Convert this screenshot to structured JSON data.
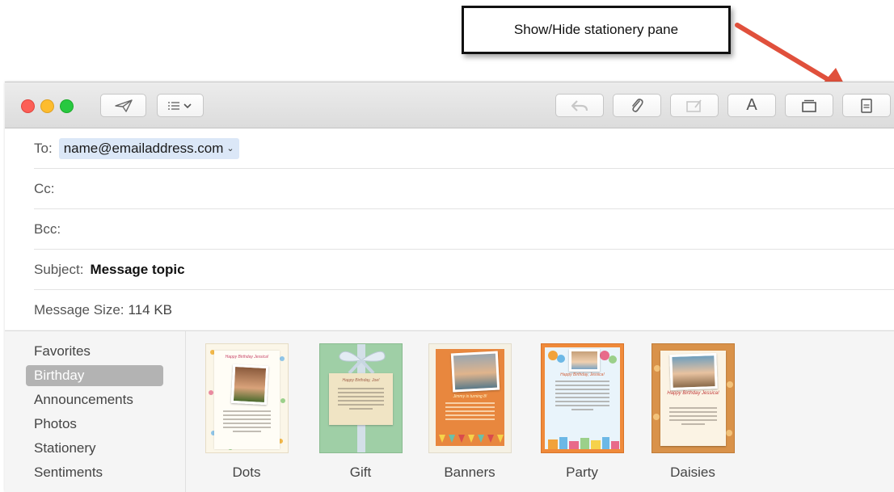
{
  "callout": {
    "text": "Show/Hide stationery pane"
  },
  "toolbar": {
    "send_icon": "paper-plane-icon",
    "header_fields_icon": "list-menu-icon",
    "reply_icon": "reply-arrow-icon",
    "attach_icon": "paperclip-icon",
    "markup_icon": "markup-photo-icon",
    "format_label": "A",
    "photo_browser_icon": "photo-browser-icon",
    "stationery_icon": "stationery-icon"
  },
  "headers": {
    "to_label": "To:",
    "to_value": "name@emailaddress.com",
    "cc_label": "Cc:",
    "bcc_label": "Bcc:",
    "subject_label": "Subject:",
    "subject_value": "Message topic",
    "size_label": "Message Size:",
    "size_value": "114 KB"
  },
  "categories": [
    "Favorites",
    "Birthday",
    "Announcements",
    "Photos",
    "Stationery",
    "Sentiments"
  ],
  "selected_category": "Birthday",
  "templates": [
    {
      "name": "Dots",
      "card_title": "Happy Birthday Jessica!"
    },
    {
      "name": "Gift",
      "card_title": "Happy Birthday, Joe!"
    },
    {
      "name": "Banners",
      "card_title": "Jimmy is turning 8!"
    },
    {
      "name": "Party",
      "card_title": "Happy Birthday, Jessica!"
    },
    {
      "name": "Daisies",
      "card_title": "Happy Birthday Jessica!"
    }
  ],
  "colors": {
    "accent_arrow": "#e0503c",
    "selected_bg": "#b3b3b3",
    "to_chip": "#dbe7f7"
  }
}
